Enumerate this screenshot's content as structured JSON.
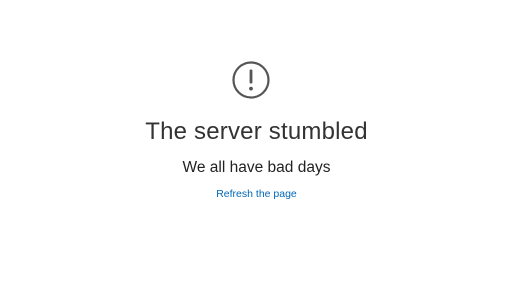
{
  "error": {
    "icon": "exclamation-circle-icon",
    "icon_color": "#555555",
    "title": "The server stumbled",
    "subtitle": "We all have bad days",
    "refresh_link": "Refresh the page",
    "link_color": "#0067b8"
  }
}
